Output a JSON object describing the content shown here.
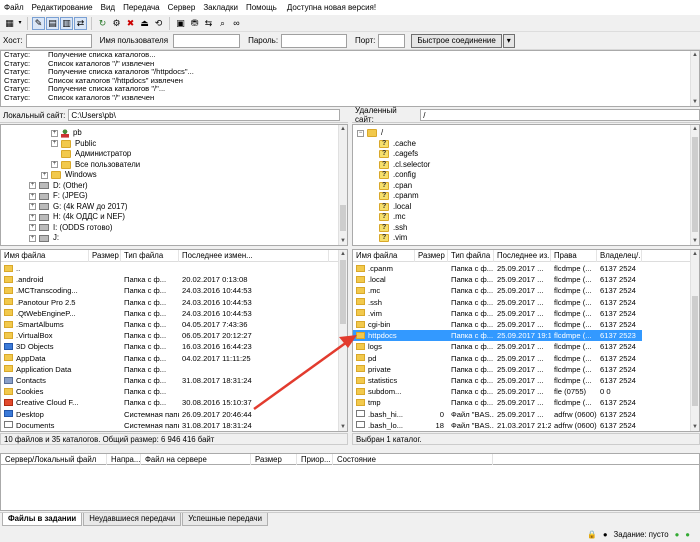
{
  "menu": [
    "Файл",
    "Редактирование",
    "Вид",
    "Передача",
    "Сервер",
    "Закладки",
    "Помощь",
    "Доступна новая версия!"
  ],
  "quickconnect": {
    "host_label": "Хост:",
    "user_label": "Имя пользователя",
    "pass_label": "Пароль:",
    "port_label": "Порт:",
    "button": "Быстрое соединение",
    "dropdown": "▾"
  },
  "log": [
    {
      "k": "Статус:",
      "v": "Получение списка каталогов..."
    },
    {
      "k": "Статус:",
      "v": "Список каталогов \"/\" извлечен"
    },
    {
      "k": "Статус:",
      "v": "Получение списка каталогов \"/httpdocs\"..."
    },
    {
      "k": "Статус:",
      "v": "Список каталогов \"/httpdocs\" извлечен"
    },
    {
      "k": "Статус:",
      "v": "Получение списка каталогов \"/\"..."
    },
    {
      "k": "Статус:",
      "v": "Список каталогов \"/\" извлечен"
    }
  ],
  "local": {
    "site_label": "Локальный сайт:",
    "path": "C:\\Users\\pb\\",
    "tree": [
      {
        "t": "pb",
        "icon": "user",
        "exp": "+"
      },
      {
        "t": "Public",
        "icon": "folder",
        "exp": "+"
      },
      {
        "t": "Администратор",
        "icon": "folder",
        "exp": ""
      },
      {
        "t": "Все пользователи",
        "icon": "folder",
        "exp": "+"
      },
      {
        "t": "Windows",
        "icon": "folder",
        "exp": "+"
      },
      {
        "t": "D: (Other)",
        "icon": "drive",
        "exp": "+"
      },
      {
        "t": "F: (JPEG)",
        "icon": "drive",
        "exp": "+"
      },
      {
        "t": "G: (4k RAW до 2017)",
        "icon": "drive",
        "exp": "+"
      },
      {
        "t": "H: (4k ОДДС и NEF)",
        "icon": "drive",
        "exp": "+"
      },
      {
        "t": "I: (ODDS готово)",
        "icon": "drive",
        "exp": "+"
      },
      {
        "t": "J:",
        "icon": "drive",
        "exp": "+"
      }
    ],
    "columns": [
      "Имя файла",
      "Размер",
      "Тип файла",
      "Последнее измен..."
    ],
    "files": [
      {
        "name": "..",
        "size": "",
        "type": "",
        "date": "",
        "icon": "folder"
      },
      {
        "name": ".android",
        "size": "",
        "type": "Папка с ф...",
        "date": "20.02.2017 0:13:08",
        "icon": "folder"
      },
      {
        "name": ".MCTranscoding...",
        "size": "",
        "type": "Папка с ф...",
        "date": "24.03.2016 10:44:53",
        "icon": "folder"
      },
      {
        "name": ".Panotour Pro 2.5",
        "size": "",
        "type": "Папка с ф...",
        "date": "24.03.2016 10:44:53",
        "icon": "folder"
      },
      {
        "name": ".QtWebEngineP...",
        "size": "",
        "type": "Папка с ф...",
        "date": "24.03.2016 10:44:53",
        "icon": "folder"
      },
      {
        "name": ".SmartAlbums",
        "size": "",
        "type": "Папка с ф...",
        "date": "04.05.2017 7:43:36",
        "icon": "folder"
      },
      {
        "name": ".VirtualBox",
        "size": "",
        "type": "Папка с ф...",
        "date": "06.05.2017 20:12:27",
        "icon": "folder"
      },
      {
        "name": "3D Objects",
        "size": "",
        "type": "Папка с ф...",
        "date": "16.03.2016 16:44:23",
        "icon": "blue"
      },
      {
        "name": "AppData",
        "size": "",
        "type": "Папка с ф...",
        "date": "04.02.2017 11:11:25",
        "icon": "folder"
      },
      {
        "name": "Application Data",
        "size": "",
        "type": "Папка с ф...",
        "date": "",
        "icon": "folder"
      },
      {
        "name": "Contacts",
        "size": "",
        "type": "Папка с ф...",
        "date": "31.08.2017 18:31:24",
        "icon": "grey"
      },
      {
        "name": "Cookies",
        "size": "",
        "type": "Папка с ф...",
        "date": "",
        "icon": "folder"
      },
      {
        "name": "Creative Cloud F...",
        "size": "",
        "type": "Папка с ф...",
        "date": "30.08.2016 15:10:37",
        "icon": "red"
      },
      {
        "name": "Desktop",
        "size": "",
        "type": "Системная папка",
        "date": "26.09.2017 20:46:44",
        "icon": "blue"
      },
      {
        "name": "Documents",
        "size": "",
        "type": "Системная папка",
        "date": "31.08.2017 18:31:24",
        "icon": "doc"
      }
    ],
    "status": "10 файлов и 35 каталогов. Общий размер: 6 946 416 байт"
  },
  "remote": {
    "site_label": "Удаленный сайт:",
    "path": "/",
    "tree": [
      {
        "t": "/",
        "icon": "folder",
        "exp": "-"
      },
      {
        "t": ".cache",
        "icon": "q",
        "exp": ""
      },
      {
        "t": ".cagefs",
        "icon": "q",
        "exp": ""
      },
      {
        "t": ".cl.selector",
        "icon": "q",
        "exp": ""
      },
      {
        "t": ".config",
        "icon": "q",
        "exp": ""
      },
      {
        "t": ".cpan",
        "icon": "q",
        "exp": ""
      },
      {
        "t": ".cpanm",
        "icon": "q",
        "exp": ""
      },
      {
        "t": ".local",
        "icon": "q",
        "exp": ""
      },
      {
        "t": ".mc",
        "icon": "q",
        "exp": ""
      },
      {
        "t": ".ssh",
        "icon": "q",
        "exp": ""
      },
      {
        "t": ".vim",
        "icon": "q",
        "exp": ""
      }
    ],
    "columns": [
      "Имя файла",
      "Размер",
      "Тип файла",
      "Последнее из...",
      "Права",
      "Владелец/..."
    ],
    "files": [
      {
        "name": ".cpanm",
        "size": "",
        "type": "Папка с ф...",
        "date": "25.09.2017 ...",
        "perm": "flcdmpe (...",
        "owner": "6137 2524",
        "icon": "folder"
      },
      {
        "name": ".local",
        "size": "",
        "type": "Папка с ф...",
        "date": "25.09.2017 ...",
        "perm": "flcdmpe (...",
        "owner": "6137 2524",
        "icon": "folder"
      },
      {
        "name": ".mc",
        "size": "",
        "type": "Папка с ф...",
        "date": "25.09.2017 ...",
        "perm": "flcdmpe (...",
        "owner": "6137 2524",
        "icon": "folder"
      },
      {
        "name": ".ssh",
        "size": "",
        "type": "Папка с ф...",
        "date": "25.09.2017 ...",
        "perm": "flcdmpe (...",
        "owner": "6137 2524",
        "icon": "folder"
      },
      {
        "name": ".vim",
        "size": "",
        "type": "Папка с ф...",
        "date": "25.09.2017 ...",
        "perm": "flcdmpe (...",
        "owner": "6137 2524",
        "icon": "folder"
      },
      {
        "name": "cgi-bin",
        "size": "",
        "type": "Папка с ф...",
        "date": "25.09.2017 ...",
        "perm": "flcdmpe (...",
        "owner": "6137 2524",
        "icon": "folder"
      },
      {
        "name": "httpdocs",
        "size": "",
        "type": "Папка с ф...",
        "date": "25.09.2017 19:1...",
        "perm": "flcdmpe (...",
        "owner": "6137 2523",
        "icon": "folder",
        "selected": true
      },
      {
        "name": "logs",
        "size": "",
        "type": "Папка с ф...",
        "date": "25.09.2017 ...",
        "perm": "flcdmpe (...",
        "owner": "6137 2524",
        "icon": "folder"
      },
      {
        "name": "pd",
        "size": "",
        "type": "Папка с ф...",
        "date": "25.09.2017 ...",
        "perm": "flcdmpe (...",
        "owner": "6137 2524",
        "icon": "folder"
      },
      {
        "name": "private",
        "size": "",
        "type": "Папка с ф...",
        "date": "25.09.2017 ...",
        "perm": "flcdmpe (...",
        "owner": "6137 2524",
        "icon": "folder"
      },
      {
        "name": "statistics",
        "size": "",
        "type": "Папка с ф...",
        "date": "25.09.2017 ...",
        "perm": "flcdmpe (...",
        "owner": "6137 2524",
        "icon": "folder"
      },
      {
        "name": "subdom...",
        "size": "",
        "type": "Папка с ф...",
        "date": "25.09.2017 ...",
        "perm": "fle (0755)",
        "owner": "0 0",
        "icon": "folder"
      },
      {
        "name": "tmp",
        "size": "",
        "type": "Папка с ф...",
        "date": "25.09.2017 ...",
        "perm": "flcdmpe (...",
        "owner": "6137 2524",
        "icon": "folder"
      },
      {
        "name": ".bash_hi...",
        "size": "0",
        "type": "Файл \"BAS...",
        "date": "25.09.2017 ...",
        "perm": "adfrw (0600)",
        "owner": "6137 2524",
        "icon": "doc"
      },
      {
        "name": ".bash_lo...",
        "size": "18",
        "type": "Файл \"BAS...",
        "date": "21.03.2017 21:2...",
        "perm": "adfrw (0600)",
        "owner": "6137 2524",
        "icon": "doc"
      }
    ],
    "status": "Выбран 1 каталог."
  },
  "queue": {
    "columns": [
      "Сервер/Локальный файл",
      "Напра...",
      "Файл на сервере",
      "Размер",
      "Приор...",
      "Состояние"
    ]
  },
  "tabs": [
    "Файлы в задании",
    "Неудавшиеся передачи",
    "Успешные передачи"
  ],
  "bottom": {
    "queue_status": "Задание: пусто"
  },
  "colors": {
    "selection": "#3399ff",
    "folder": "#f2c94c",
    "annotation_arrow": "#e23b2e"
  }
}
